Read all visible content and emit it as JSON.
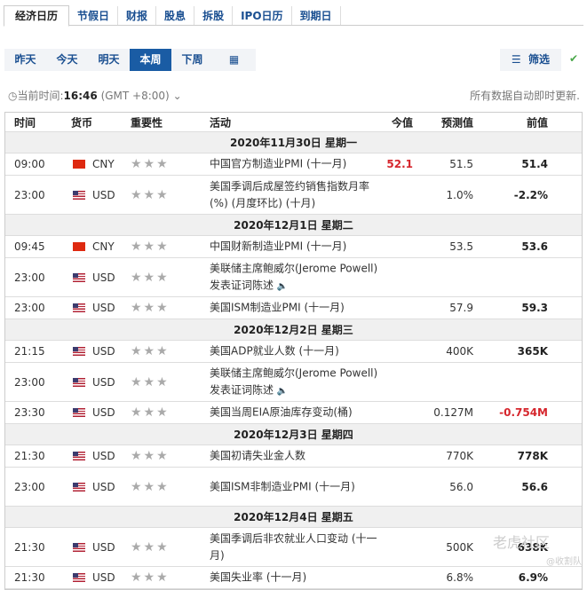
{
  "tabs": [
    "经济日历",
    "节假日",
    "财报",
    "股息",
    "拆股",
    "IPO日历",
    "到期日"
  ],
  "periods": [
    "昨天",
    "今天",
    "明天",
    "本周",
    "下周"
  ],
  "filter_label": "筛选",
  "clock": {
    "label": "当前时间:",
    "time": "16:46",
    "tz": "(GMT +8:00)"
  },
  "auto_update": "所有数据自动即时更新.",
  "headers": {
    "time": "时间",
    "currency": "货币",
    "importance": "重要性",
    "event": "活动",
    "actual": "今值",
    "forecast": "预测值",
    "previous": "前值"
  },
  "days": [
    {
      "date": "2020年11月30日  星期一",
      "events": [
        {
          "time": "09:00",
          "flag": "cn",
          "currency": "CNY",
          "event": "中国官方制造业PMI (十一月)",
          "actual": "52.1",
          "forecast": "51.5",
          "previous": "51.4"
        },
        {
          "time": "23:00",
          "flag": "us",
          "currency": "USD",
          "event": "美国季调后成屋签约销售指数月率(%) (月度环比) (十月)",
          "actual": "",
          "forecast": "1.0%",
          "previous": "-2.2%"
        }
      ]
    },
    {
      "date": "2020年12月1日  星期二",
      "events": [
        {
          "time": "09:45",
          "flag": "cn",
          "currency": "CNY",
          "event": "中国财新制造业PMI (十一月)",
          "actual": "",
          "forecast": "53.5",
          "previous": "53.6"
        },
        {
          "time": "23:00",
          "flag": "us",
          "currency": "USD",
          "event": "美联储主席鲍威尔(Jerome Powell)发表证词陈述",
          "speech": true,
          "actual": "",
          "forecast": "",
          "previous": ""
        },
        {
          "time": "23:00",
          "flag": "us",
          "currency": "USD",
          "event": "美国ISM制造业PMI (十一月)",
          "actual": "",
          "forecast": "57.9",
          "previous": "59.3"
        }
      ]
    },
    {
      "date": "2020年12月2日  星期三",
      "events": [
        {
          "time": "21:15",
          "flag": "us",
          "currency": "USD",
          "event": "美国ADP就业人数 (十一月)",
          "actual": "",
          "forecast": "400K",
          "previous": "365K"
        },
        {
          "time": "23:00",
          "flag": "us",
          "currency": "USD",
          "event": "美联储主席鲍威尔(Jerome Powell)发表证词陈述",
          "speech": true,
          "actual": "",
          "forecast": "",
          "previous": ""
        },
        {
          "time": "23:30",
          "flag": "us",
          "currency": "USD",
          "event": "美国当周EIA原油库存变动(桶)",
          "actual": "",
          "forecast": "0.127M",
          "previous": "-0.754M",
          "prev_red": true
        }
      ]
    },
    {
      "date": "2020年12月3日  星期四",
      "events": [
        {
          "time": "21:30",
          "flag": "us",
          "currency": "USD",
          "event": "美国初请失业金人数",
          "actual": "",
          "forecast": "770K",
          "previous": "778K"
        },
        {
          "time": "23:00",
          "flag": "us",
          "currency": "USD",
          "event": "美国ISM非制造业PMI (十一月)",
          "actual": "",
          "forecast": "56.0",
          "previous": "56.6"
        }
      ]
    },
    {
      "date": "2020年12月4日  星期五",
      "events": [
        {
          "time": "21:30",
          "flag": "us",
          "currency": "USD",
          "event": "美国季调后非农就业人口变动 (十一月)",
          "actual": "",
          "forecast": "500K",
          "previous": "638K"
        },
        {
          "time": "21:30",
          "flag": "us",
          "currency": "USD",
          "event": "美国失业率 (十一月)",
          "actual": "",
          "forecast": "6.8%",
          "previous": "6.9%"
        }
      ]
    }
  ],
  "stars": "★★★",
  "watermark": "老虎社区",
  "watermark2": "@收割队"
}
